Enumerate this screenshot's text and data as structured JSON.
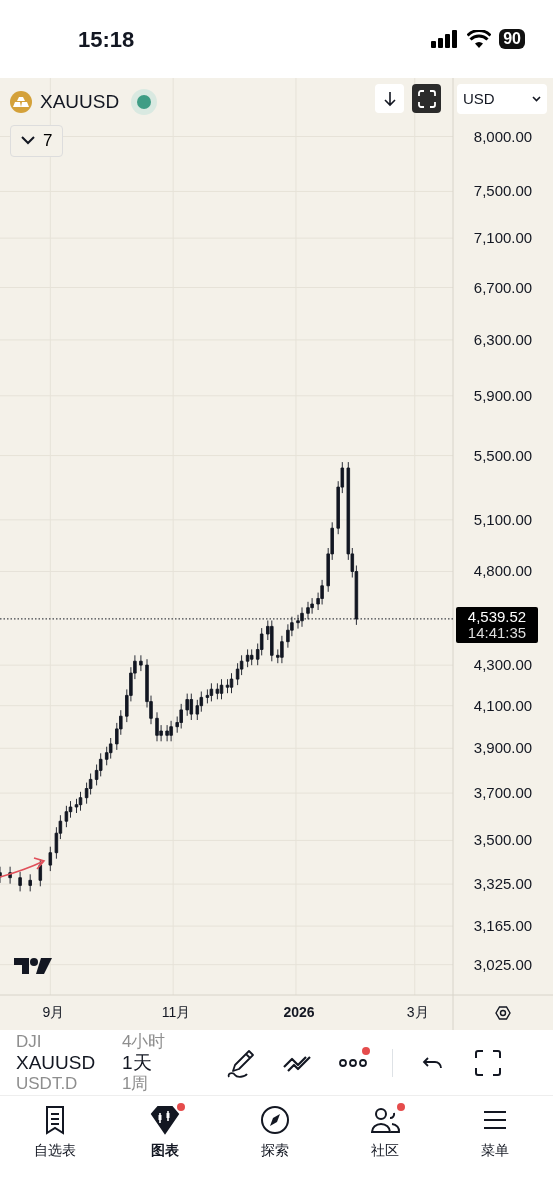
{
  "status_bar": {
    "time": "15:18",
    "battery": "90"
  },
  "chart_header": {
    "symbol": "XAUUSD",
    "market_open": true,
    "indicators_count": "7",
    "currency": "USD"
  },
  "chart": {
    "price_axis": [
      "8,000.00",
      "7,500.00",
      "7,100.00",
      "6,700.00",
      "6,300.00",
      "5,900.00",
      "5,500.00",
      "5,100.00",
      "4,800.00",
      "4,300.00",
      "4,100.00",
      "3,900.00",
      "3,700.00",
      "3,500.00",
      "3,325.00",
      "3,165.00",
      "3,025.00"
    ],
    "time_axis": [
      "9月",
      "11月",
      "**2026**",
      "3月"
    ],
    "price_tag": {
      "price": "4,539.52",
      "countdown": "14:41:35"
    }
  },
  "toolbar": {
    "symbols": [
      {
        "label": "DJI",
        "selected": false
      },
      {
        "label": "XAUUSD",
        "selected": true
      },
      {
        "label": "USDT.D",
        "selected": false
      }
    ],
    "intervals": [
      {
        "label": "4小时",
        "selected": false
      },
      {
        "label": "1天",
        "selected": true
      },
      {
        "label": "1周",
        "selected": false
      }
    ],
    "tools": [
      {
        "kind": "draw",
        "badge": false
      },
      {
        "kind": "indicators",
        "badge": false
      },
      {
        "kind": "more",
        "badge": true
      },
      {
        "kind": "undo",
        "badge": false
      },
      {
        "kind": "fullscreen",
        "badge": false
      }
    ]
  },
  "tab_bar": [
    {
      "kind": "watchlist",
      "label": "自选表",
      "selected": false,
      "badge": false
    },
    {
      "kind": "chart",
      "label": "图表",
      "selected": true,
      "badge": true
    },
    {
      "kind": "explore",
      "label": "探索",
      "selected": false,
      "badge": false
    },
    {
      "kind": "community",
      "label": "社区",
      "selected": false,
      "badge": true
    },
    {
      "kind": "menu",
      "label": "菜单",
      "selected": false,
      "badge": false
    }
  ]
}
